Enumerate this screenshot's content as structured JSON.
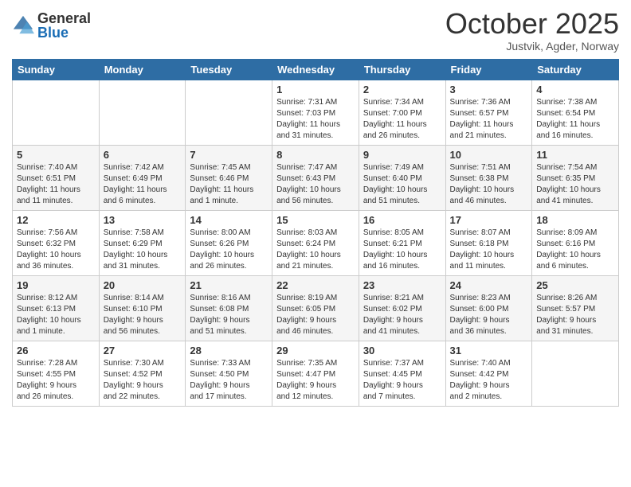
{
  "header": {
    "logo_general": "General",
    "logo_blue": "Blue",
    "month_title": "October 2025",
    "location": "Justvik, Agder, Norway"
  },
  "days_of_week": [
    "Sunday",
    "Monday",
    "Tuesday",
    "Wednesday",
    "Thursday",
    "Friday",
    "Saturday"
  ],
  "weeks": [
    [
      {
        "day": "",
        "info": ""
      },
      {
        "day": "",
        "info": ""
      },
      {
        "day": "",
        "info": ""
      },
      {
        "day": "1",
        "info": "Sunrise: 7:31 AM\nSunset: 7:03 PM\nDaylight: 11 hours\nand 31 minutes."
      },
      {
        "day": "2",
        "info": "Sunrise: 7:34 AM\nSunset: 7:00 PM\nDaylight: 11 hours\nand 26 minutes."
      },
      {
        "day": "3",
        "info": "Sunrise: 7:36 AM\nSunset: 6:57 PM\nDaylight: 11 hours\nand 21 minutes."
      },
      {
        "day": "4",
        "info": "Sunrise: 7:38 AM\nSunset: 6:54 PM\nDaylight: 11 hours\nand 16 minutes."
      }
    ],
    [
      {
        "day": "5",
        "info": "Sunrise: 7:40 AM\nSunset: 6:51 PM\nDaylight: 11 hours\nand 11 minutes."
      },
      {
        "day": "6",
        "info": "Sunrise: 7:42 AM\nSunset: 6:49 PM\nDaylight: 11 hours\nand 6 minutes."
      },
      {
        "day": "7",
        "info": "Sunrise: 7:45 AM\nSunset: 6:46 PM\nDaylight: 11 hours\nand 1 minute."
      },
      {
        "day": "8",
        "info": "Sunrise: 7:47 AM\nSunset: 6:43 PM\nDaylight: 10 hours\nand 56 minutes."
      },
      {
        "day": "9",
        "info": "Sunrise: 7:49 AM\nSunset: 6:40 PM\nDaylight: 10 hours\nand 51 minutes."
      },
      {
        "day": "10",
        "info": "Sunrise: 7:51 AM\nSunset: 6:38 PM\nDaylight: 10 hours\nand 46 minutes."
      },
      {
        "day": "11",
        "info": "Sunrise: 7:54 AM\nSunset: 6:35 PM\nDaylight: 10 hours\nand 41 minutes."
      }
    ],
    [
      {
        "day": "12",
        "info": "Sunrise: 7:56 AM\nSunset: 6:32 PM\nDaylight: 10 hours\nand 36 minutes."
      },
      {
        "day": "13",
        "info": "Sunrise: 7:58 AM\nSunset: 6:29 PM\nDaylight: 10 hours\nand 31 minutes."
      },
      {
        "day": "14",
        "info": "Sunrise: 8:00 AM\nSunset: 6:26 PM\nDaylight: 10 hours\nand 26 minutes."
      },
      {
        "day": "15",
        "info": "Sunrise: 8:03 AM\nSunset: 6:24 PM\nDaylight: 10 hours\nand 21 minutes."
      },
      {
        "day": "16",
        "info": "Sunrise: 8:05 AM\nSunset: 6:21 PM\nDaylight: 10 hours\nand 16 minutes."
      },
      {
        "day": "17",
        "info": "Sunrise: 8:07 AM\nSunset: 6:18 PM\nDaylight: 10 hours\nand 11 minutes."
      },
      {
        "day": "18",
        "info": "Sunrise: 8:09 AM\nSunset: 6:16 PM\nDaylight: 10 hours\nand 6 minutes."
      }
    ],
    [
      {
        "day": "19",
        "info": "Sunrise: 8:12 AM\nSunset: 6:13 PM\nDaylight: 10 hours\nand 1 minute."
      },
      {
        "day": "20",
        "info": "Sunrise: 8:14 AM\nSunset: 6:10 PM\nDaylight: 9 hours\nand 56 minutes."
      },
      {
        "day": "21",
        "info": "Sunrise: 8:16 AM\nSunset: 6:08 PM\nDaylight: 9 hours\nand 51 minutes."
      },
      {
        "day": "22",
        "info": "Sunrise: 8:19 AM\nSunset: 6:05 PM\nDaylight: 9 hours\nand 46 minutes."
      },
      {
        "day": "23",
        "info": "Sunrise: 8:21 AM\nSunset: 6:02 PM\nDaylight: 9 hours\nand 41 minutes."
      },
      {
        "day": "24",
        "info": "Sunrise: 8:23 AM\nSunset: 6:00 PM\nDaylight: 9 hours\nand 36 minutes."
      },
      {
        "day": "25",
        "info": "Sunrise: 8:26 AM\nSunset: 5:57 PM\nDaylight: 9 hours\nand 31 minutes."
      }
    ],
    [
      {
        "day": "26",
        "info": "Sunrise: 7:28 AM\nSunset: 4:55 PM\nDaylight: 9 hours\nand 26 minutes."
      },
      {
        "day": "27",
        "info": "Sunrise: 7:30 AM\nSunset: 4:52 PM\nDaylight: 9 hours\nand 22 minutes."
      },
      {
        "day": "28",
        "info": "Sunrise: 7:33 AM\nSunset: 4:50 PM\nDaylight: 9 hours\nand 17 minutes."
      },
      {
        "day": "29",
        "info": "Sunrise: 7:35 AM\nSunset: 4:47 PM\nDaylight: 9 hours\nand 12 minutes."
      },
      {
        "day": "30",
        "info": "Sunrise: 7:37 AM\nSunset: 4:45 PM\nDaylight: 9 hours\nand 7 minutes."
      },
      {
        "day": "31",
        "info": "Sunrise: 7:40 AM\nSunset: 4:42 PM\nDaylight: 9 hours\nand 2 minutes."
      },
      {
        "day": "",
        "info": ""
      }
    ]
  ]
}
